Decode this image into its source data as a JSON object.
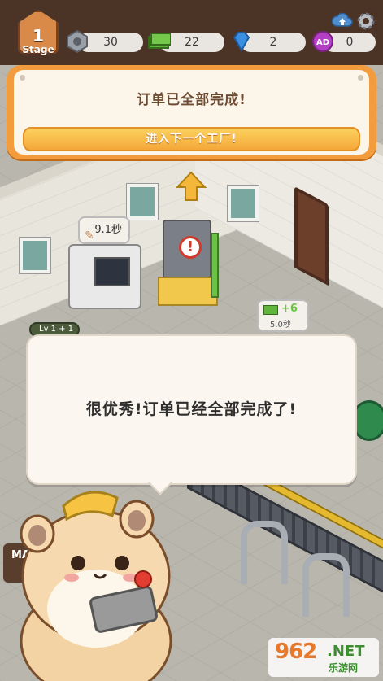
{
  "hud": {
    "stage_number": "1",
    "stage_label": "Stage",
    "resources": [
      {
        "icon": "hex-nut-icon",
        "value": "30"
      },
      {
        "icon": "cash-icon",
        "value": "22"
      },
      {
        "icon": "diamond-icon",
        "value": "2"
      },
      {
        "icon": "ad-token-icon",
        "value": "0"
      }
    ]
  },
  "banner": {
    "title": "订单已全部完成!",
    "button_label": "进入下一个工厂!"
  },
  "scene": {
    "machine_timer": "9.1秒",
    "reward_amount": "+6",
    "reward_time": "5.0秒",
    "level_tag": "Lv 1 + 1",
    "sign_text": "MA"
  },
  "dialog": {
    "message": "很优秀!订单已经全部完成了!"
  },
  "watermark": {
    "number": "962",
    "suffix": ".NET",
    "site": "乐游网"
  },
  "colors": {
    "banner_orange": "#f39c3d",
    "button_yellow": "#fcd15e",
    "hud_brown": "#4b3326",
    "cash_green": "#61b43c",
    "diamond_blue": "#3b8fe0",
    "ad_purple": "#b23fc4"
  }
}
